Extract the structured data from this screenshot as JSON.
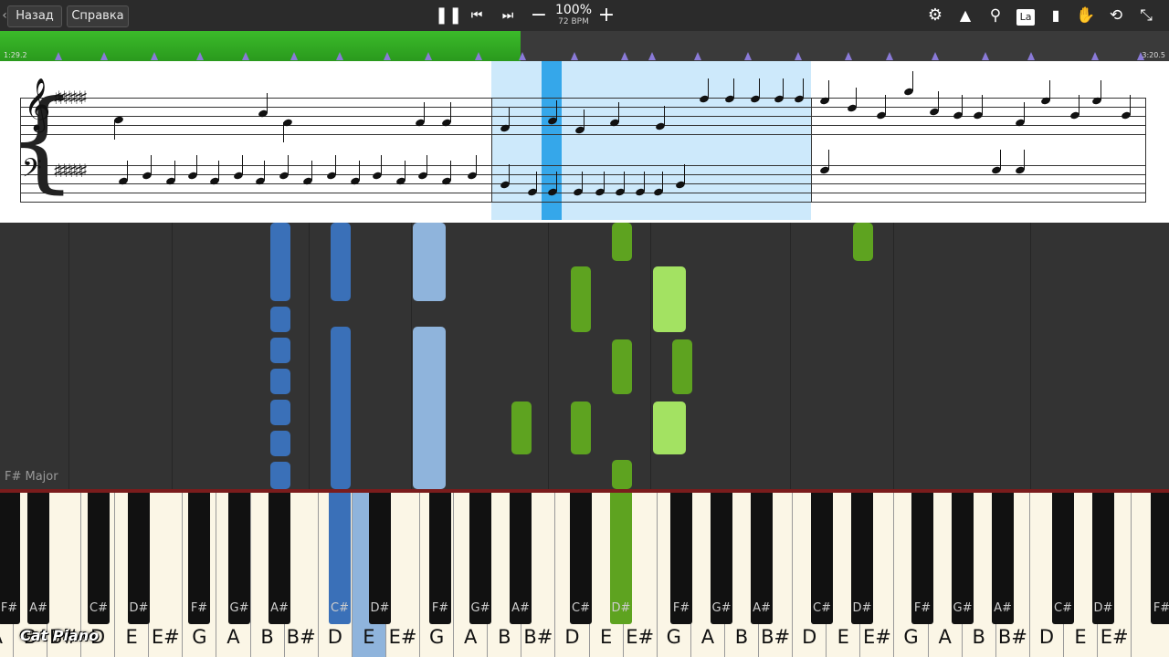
{
  "toolbar": {
    "back_label": "Назад",
    "help_label": "Справка",
    "tempo_percent": "100%",
    "tempo_bpm": "72 BPM",
    "icons": [
      "pause-icon",
      "skip-back-icon",
      "skip-forward-icon",
      "minus-icon",
      "plus-icon",
      "gear-icon",
      "metronome-icon",
      "search-icon",
      "note-label-icon",
      "bookmark-icon",
      "hand-icon",
      "loop-icon",
      "collapse-icon"
    ]
  },
  "progress": {
    "elapsed": "1:29.2",
    "total": "3:20.5",
    "fraction": 0.445,
    "accent": "#35b023"
  },
  "sheet": {
    "cursor_color": "#35a7ea",
    "highlight_color": "#cde9fb"
  },
  "roll": {
    "key_signature": "F# Major",
    "colors": {
      "left_hand_dark": "#3a70b8",
      "left_hand_light": "#8fb4dc",
      "right_hand_dark": "#5ea320",
      "right_hand_light": "#a3e262"
    }
  },
  "keyboard": {
    "white_labels": [
      "A",
      "B",
      "B#",
      "D",
      "E",
      "E#",
      "G",
      "A",
      "B",
      "B#",
      "D",
      "E",
      "E#",
      "G",
      "A",
      "B",
      "B#",
      "D",
      "E",
      "E#",
      "G",
      "A",
      "B",
      "B#",
      "D",
      "E",
      "E#",
      "G",
      "A",
      "B",
      "B#",
      "D",
      "E",
      "E#"
    ],
    "black_labels": [
      "F#",
      "A#",
      "C#",
      "D#",
      "F#",
      "G#",
      "A#",
      "C#",
      "D#",
      "F#",
      "G#",
      "A#",
      "C#",
      "D#",
      "F#",
      "G#",
      "A#",
      "C#",
      "D#",
      "F#",
      "G#",
      "A#",
      "C#",
      "D#",
      "F#"
    ],
    "logo": "Cat Piano"
  }
}
